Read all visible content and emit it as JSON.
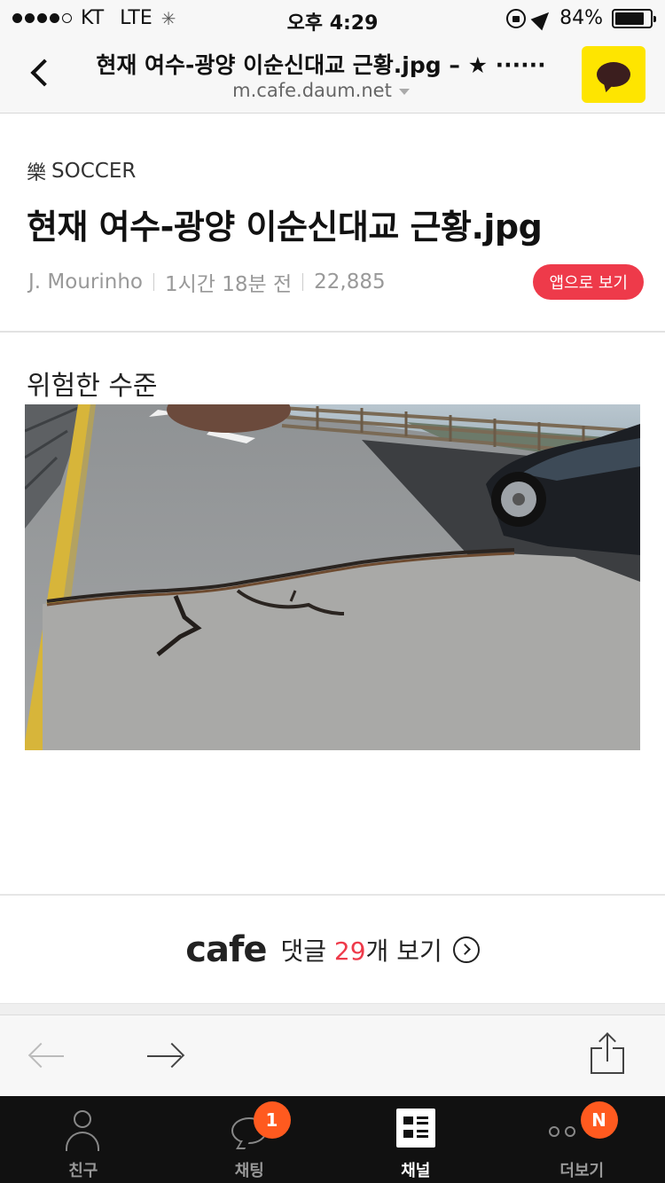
{
  "status_bar": {
    "carrier": "KT",
    "network": "LTE",
    "time": "오후 4:29",
    "battery": "84%",
    "battery_level": 0.84
  },
  "nav": {
    "title": "현재 여수-광양 이순신대교 근황.jpg – ★ ······",
    "url": "m.cafe.daum.net"
  },
  "article": {
    "category_icon": "樂",
    "category": "SOCCER",
    "title": "현재 여수-광양 이순신대교 근황.jpg",
    "author": "J. Mourinho",
    "time_ago": "1시간 18분 전",
    "views": "22,885",
    "open_in_app": "앱으로 보기",
    "body_text": "위험한 수준"
  },
  "comments": {
    "logo": "cafe",
    "prefix": "댓글 ",
    "count": "29",
    "suffix": "개 보기"
  },
  "tab_bar": {
    "items": [
      {
        "label": "친구",
        "icon": "friend-icon",
        "active": false
      },
      {
        "label": "채팅",
        "icon": "chat-icon",
        "badge": "1",
        "active": false
      },
      {
        "label": "채널",
        "icon": "channel-icon",
        "active": true
      },
      {
        "label": "더보기",
        "icon": "more-icon",
        "badge": "N",
        "active": false
      }
    ]
  },
  "colors": {
    "accent": "#ee3a4a",
    "kakao_yellow": "#fee500",
    "badge_orange": "#ff5a1f",
    "tab_bg": "#111111"
  }
}
